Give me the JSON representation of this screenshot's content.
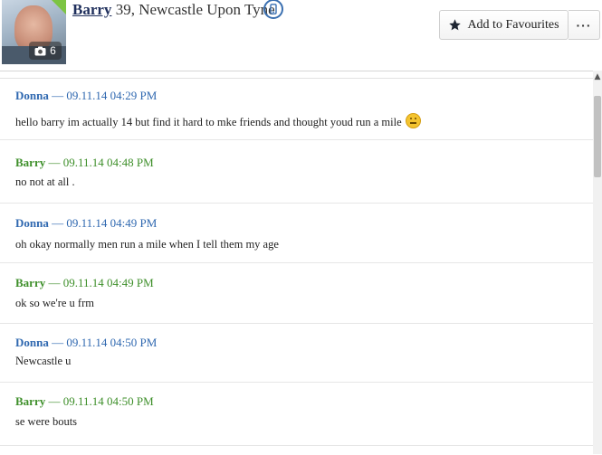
{
  "profile": {
    "name": "Barry",
    "meta": " 39, Newcastle Upon Tyne",
    "photo_count": "6",
    "phone_icon": "phone-icon"
  },
  "actions": {
    "favourites_label": "Add to Favourites",
    "more_label": "···"
  },
  "messages": [
    {
      "author": "Donna",
      "timestamp": "09.11.14 04:29 PM",
      "text": "hello barry im actually 14 but find it hard to mke friends and thought youd run a mile",
      "emoji": "sad-face-emoji"
    },
    {
      "author": "Barry",
      "timestamp": "09.11.14 04:48 PM",
      "text": "no not at all ."
    },
    {
      "author": "Donna",
      "timestamp": "09.11.14 04:49 PM",
      "text": "oh okay normally men run a mile when I tell them my age"
    },
    {
      "author": "Barry",
      "timestamp": "09.11.14 04:49 PM",
      "text": "ok so we're u frm"
    },
    {
      "author": "Donna",
      "timestamp": "09.11.14 04:50 PM",
      "text": "Newcastle u"
    },
    {
      "author": "Barry",
      "timestamp": "09.11.14 04:50 PM",
      "text": "se were bouts"
    }
  ],
  "separator": " — ",
  "colors": {
    "donna": "#2f68b0",
    "barry": "#3e8f2a",
    "name": "#1f2f5c"
  }
}
